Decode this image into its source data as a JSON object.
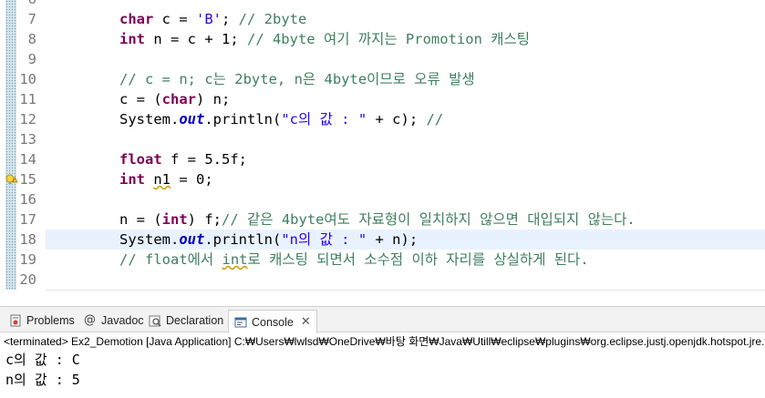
{
  "editor": {
    "partial_top_line_number": "6",
    "lines": [
      {
        "number": "7",
        "tokens": [
          [
            "kw",
            "char"
          ],
          [
            "t",
            " c = "
          ],
          [
            "str",
            "'B'"
          ],
          [
            "t",
            "; "
          ],
          [
            "cm",
            "// 2byte"
          ]
        ]
      },
      {
        "number": "8",
        "tokens": [
          [
            "kw",
            "int"
          ],
          [
            "t",
            " n = c + 1; "
          ],
          [
            "cm",
            "// 4byte 여기 까지는 Promotion 캐스팅"
          ]
        ]
      },
      {
        "number": "9",
        "tokens": []
      },
      {
        "number": "10",
        "tokens": [
          [
            "cm",
            "// c = n; c는 2byte, n은 4byte이므로 오류 발생"
          ]
        ]
      },
      {
        "number": "11",
        "tokens": [
          [
            "t",
            "c = ("
          ],
          [
            "kw",
            "char"
          ],
          [
            "t",
            ") n;"
          ]
        ]
      },
      {
        "number": "12",
        "tokens": [
          [
            "t",
            "System."
          ],
          [
            "fld",
            "out"
          ],
          [
            "t",
            ".println("
          ],
          [
            "str",
            "\"c의 값 : \""
          ],
          [
            "t",
            " + c); "
          ],
          [
            "cm",
            "//"
          ]
        ]
      },
      {
        "number": "13",
        "tokens": []
      },
      {
        "number": "14",
        "tokens": [
          [
            "kw",
            "float"
          ],
          [
            "t",
            " f = 5.5f;"
          ]
        ]
      },
      {
        "number": "15",
        "tokens": [
          [
            "kw",
            "int"
          ],
          [
            "t",
            " "
          ],
          [
            "warn",
            "n1"
          ],
          [
            "t",
            " = 0;"
          ]
        ]
      },
      {
        "number": "16",
        "tokens": []
      },
      {
        "number": "17",
        "tokens": [
          [
            "t",
            "n = ("
          ],
          [
            "kw",
            "int"
          ],
          [
            "t",
            ") f;"
          ],
          [
            "cm",
            "// 같은 4byte여도 자료형이 일치하지 않으면 대입되지 않는다."
          ]
        ]
      },
      {
        "number": "18",
        "tokens": [
          [
            "t",
            "System."
          ],
          [
            "fld",
            "out"
          ],
          [
            "t",
            ".println("
          ],
          [
            "str",
            "\"n의 값 : \""
          ],
          [
            "t",
            " + n);"
          ]
        ],
        "current": true
      },
      {
        "number": "19",
        "tokens": [
          [
            "cm",
            "// float에서 "
          ],
          [
            "cmwarn",
            "int"
          ],
          [
            "cm",
            "로 캐스팅 되면서 소수점 이하 자리를 상실하게 된다."
          ]
        ]
      },
      {
        "number": "20",
        "tokens": []
      }
    ]
  },
  "tabs": {
    "problems": "Problems",
    "javadoc": "Javadoc",
    "declaration": "Declaration",
    "console": "Console"
  },
  "console": {
    "header": "<terminated> Ex2_Demotion [Java Application] C:₩Users₩lwlsd₩OneDrive₩바탕 화면₩Java₩Utill₩eclipse₩plugins₩org.eclipse.justj.openjdk.hotspot.jre.full",
    "output": [
      "c의 값 : C",
      "n의 값 : 5"
    ]
  },
  "colors": {
    "keyword": "#7f0055",
    "string": "#2a00ff",
    "comment": "#3f7f5f",
    "field": "#0000c0",
    "current_line": "#e8f2fe"
  }
}
